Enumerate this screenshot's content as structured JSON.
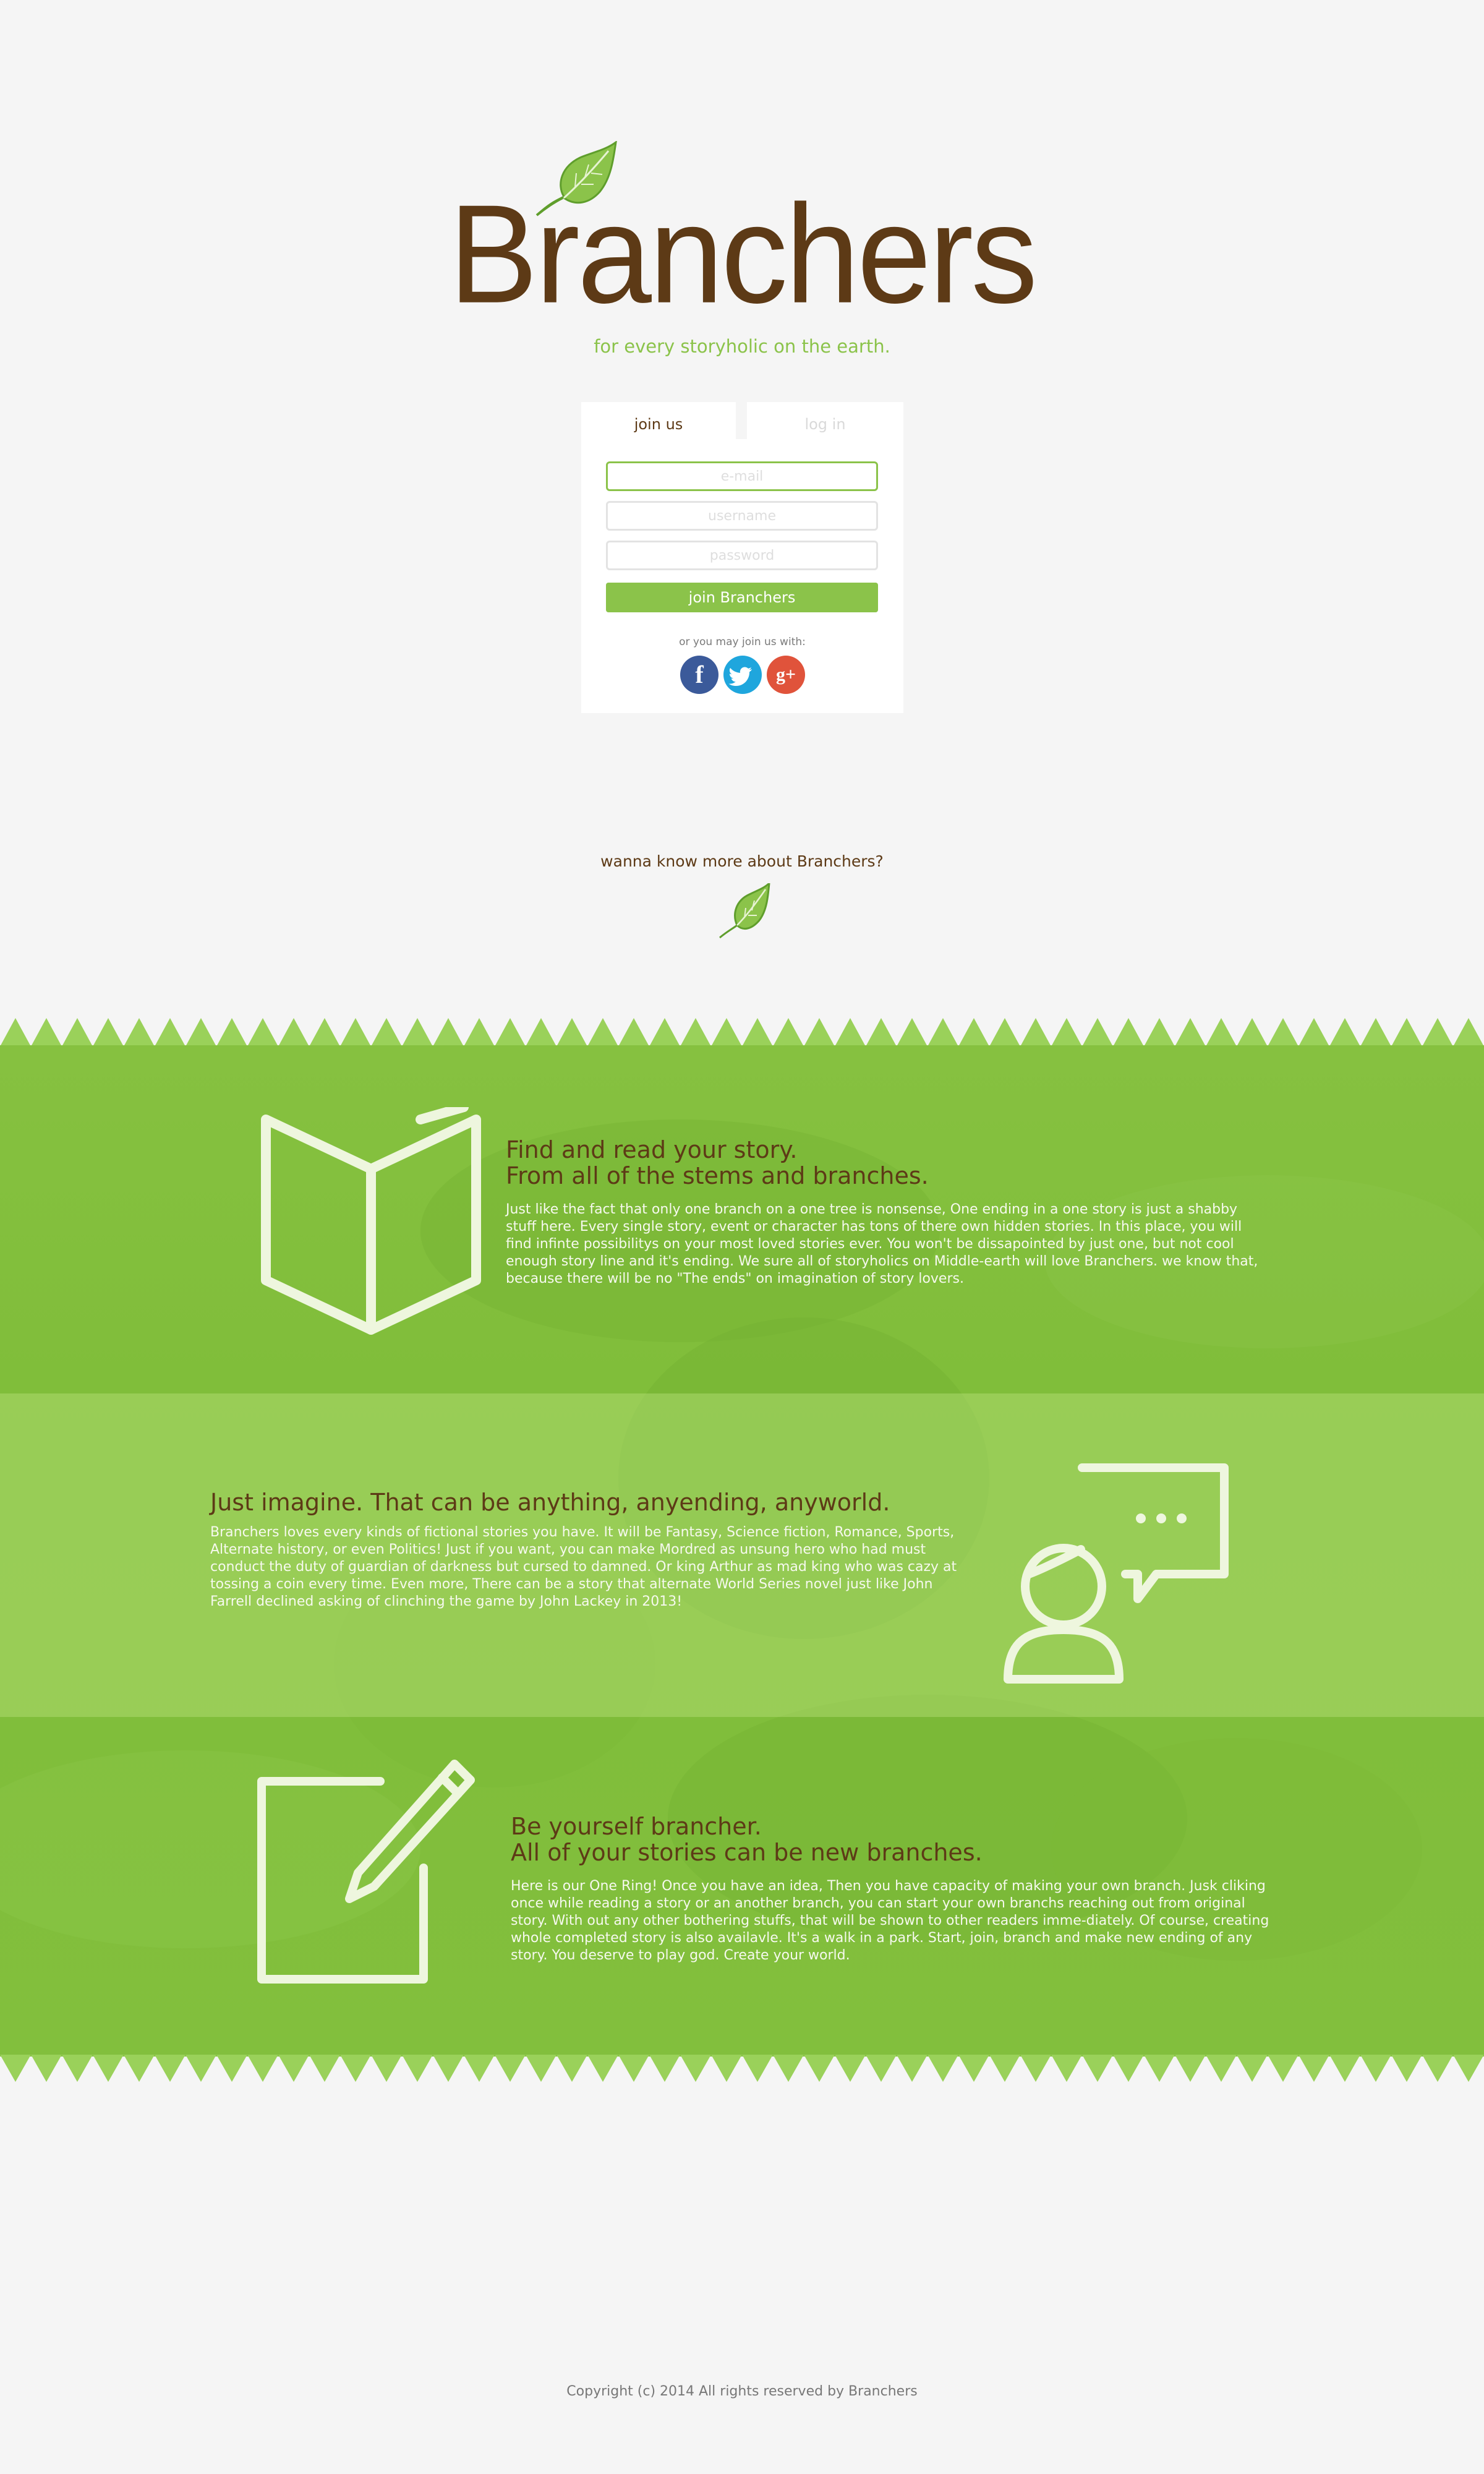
{
  "header": {
    "brand": "Branchers",
    "tagline": "for every storyholic on the earth."
  },
  "form": {
    "tabs": [
      {
        "label": "join us",
        "active": true
      },
      {
        "label": "log in",
        "active": false
      }
    ],
    "email_placeholder": "e-mail",
    "username_placeholder": "username",
    "password_placeholder": "password",
    "submit_label": "join Branchers",
    "alt_join_label": "or you may join us with:",
    "social": [
      {
        "name": "facebook-icon",
        "glyph": "f",
        "color": "#3b5a9a"
      },
      {
        "name": "twitter-icon",
        "glyph": "t",
        "color": "#1fa6dd"
      },
      {
        "name": "google-plus-icon",
        "glyph": "g+",
        "color": "#e0533b"
      }
    ]
  },
  "more": {
    "label": "wanna know more about Branchers?"
  },
  "features": [
    {
      "icon": "open-book-icon",
      "title_line1": "Find and read your story.",
      "title_line2": "From all of the stems and branches.",
      "body": "Just like the fact that only one branch on a one tree is nonsense, One ending in a one story is just a shabby stuff here. Every single story, event or character has tons of there own hidden stories. In this place, you will find infinte possibilitys on your most loved stories ever. You won't be dissapointed by just one, but not cool enough story line and it's ending. We sure all of storyholics on Middle-earth will love Branchers. we know that, because there will be no \"The ends\" on imagination of story lovers."
    },
    {
      "icon": "person-speech-bubble-icon",
      "title_line1": "Just imagine. That can be anything, anyending, anyworld.",
      "body": "Branchers loves every kinds of fictional stories you have. It will be Fantasy, Science fiction, Romance, Sports, Alternate history, or even Politics! Just if you want, you can make Mordred as unsung hero who had must conduct the duty of guardian of darkness but cursed to damned. Or king Arthur as mad king who was cazy at tossing a coin every time. Even more, There can be a story that alternate World Series novel just like John Farrell declined asking of clinching the game by John Lackey in 2013!"
    },
    {
      "icon": "edit-pencil-icon",
      "title_line1": "Be yourself brancher.",
      "title_line2": "All of your stories can be new branches.",
      "body": "Here is our One Ring! Once you have an idea, Then you have capacity of making your own branch. Jusk cliking once while reading a story or an another branch, you can start your own branchs reaching out from original story. With out any other bothering stuffs, that will be shown to other readers imme-diately. Of course, creating whole completed story is also availavle. It's a walk in a park. Start, join, branch and make new ending of any story. You deserve to play god. Create your world."
    }
  ],
  "footer": {
    "copyright": "Copyright (c) 2014 All rights reserved by Branchers"
  },
  "colors": {
    "brand_brown": "#5d3a16",
    "accent_green": "#8bc34a",
    "band_green": "#7fbd39",
    "background": "#f5f5f5"
  }
}
